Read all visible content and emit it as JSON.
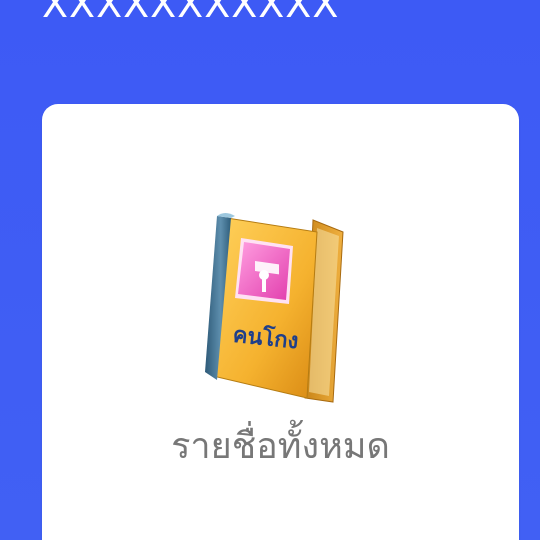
{
  "header": {
    "title": "XXXXXXXXXXX"
  },
  "card": {
    "icon": "address-book-icon",
    "book_cover_text": "คนโกง",
    "label": "รายชื่อทั้งหมด"
  },
  "colors": {
    "background": "#3f5cf3",
    "card": "#ffffff",
    "label_text": "#777777",
    "book_cover": "#f5b830",
    "book_spine": "#3b6e8c",
    "book_sticker": "#ee55b8"
  }
}
